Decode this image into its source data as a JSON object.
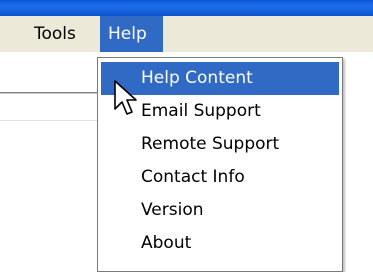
{
  "menubar": {
    "partial_label": ":",
    "tools_label": "Tools",
    "help_label": "Help"
  },
  "help_menu": {
    "items": [
      {
        "label": "Help Content",
        "highlighted": true
      },
      {
        "label": "Email Support"
      },
      {
        "label": "Remote Support"
      },
      {
        "label": "Contact Info"
      },
      {
        "label": "Version"
      },
      {
        "label": "About"
      }
    ]
  },
  "colors": {
    "highlight": "#316ac5",
    "menubar_bg": "#ece9d8",
    "title_bar": "#0b53d0"
  },
  "icons": {
    "cursor": "mouse-pointer-icon"
  }
}
